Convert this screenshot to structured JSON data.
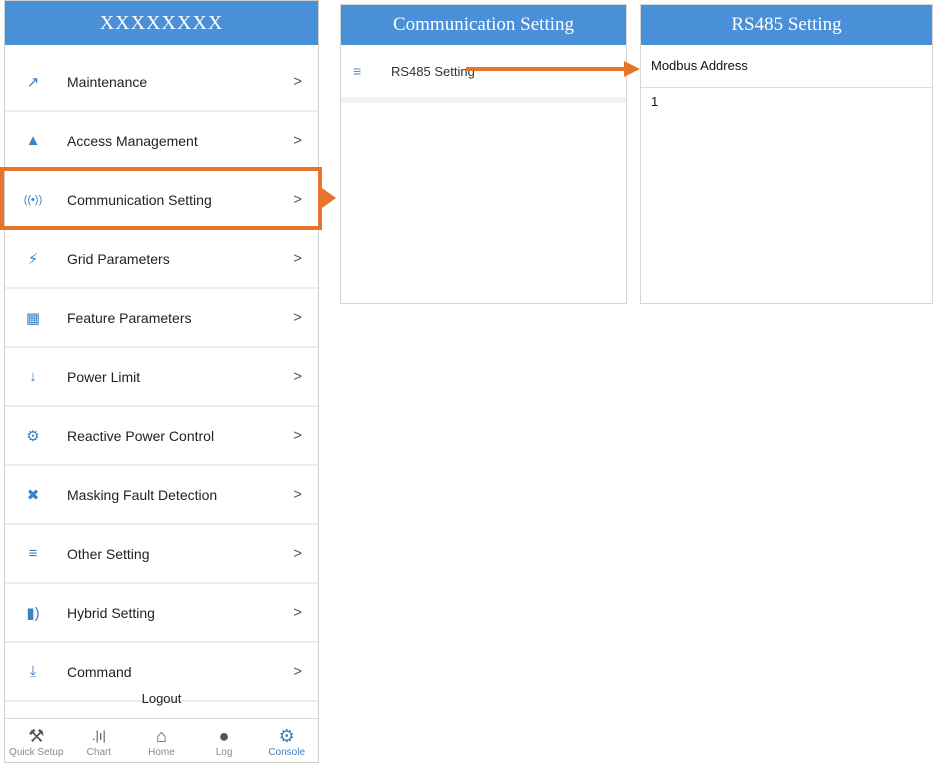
{
  "left_panel": {
    "title": "XXXXXXXX",
    "menu": [
      {
        "label": "Maintenance",
        "icon": "wrench-icon"
      },
      {
        "label": "Access Management",
        "icon": "user-icon"
      },
      {
        "label": "Communication Setting",
        "icon": "signal-icon"
      },
      {
        "label": "Grid Parameters",
        "icon": "lightning-icon"
      },
      {
        "label": "Feature Parameters",
        "icon": "grid-icon"
      },
      {
        "label": "Power Limit",
        "icon": "down-arrow-icon"
      },
      {
        "label": "Reactive Power Control",
        "icon": "gear-icon"
      },
      {
        "label": "Masking Fault Detection",
        "icon": "muted-bell-icon"
      },
      {
        "label": "Other Setting",
        "icon": "menu-lines-icon"
      },
      {
        "label": "Hybrid Setting",
        "icon": "battery-icon"
      },
      {
        "label": "Command",
        "icon": "command-arrow-icon"
      }
    ],
    "chevron": ">",
    "logout": "Logout",
    "tabs": [
      {
        "label": "Quick Setup",
        "icon": "tools-icon"
      },
      {
        "label": "Chart",
        "icon": "chart-icon"
      },
      {
        "label": "Home",
        "icon": "home-icon"
      },
      {
        "label": "Log",
        "icon": "info-icon"
      },
      {
        "label": "Console",
        "icon": "gear-icon",
        "active": true
      }
    ]
  },
  "middle_panel": {
    "title": "Communication Setting",
    "item": "RS485 Setting"
  },
  "right_panel": {
    "title": "RS485 Setting",
    "field_label": "Modbus Address",
    "field_value": "1"
  },
  "colors": {
    "header": "#4a90d9",
    "highlight": "#e8742c",
    "accent": "#3b82c4"
  }
}
